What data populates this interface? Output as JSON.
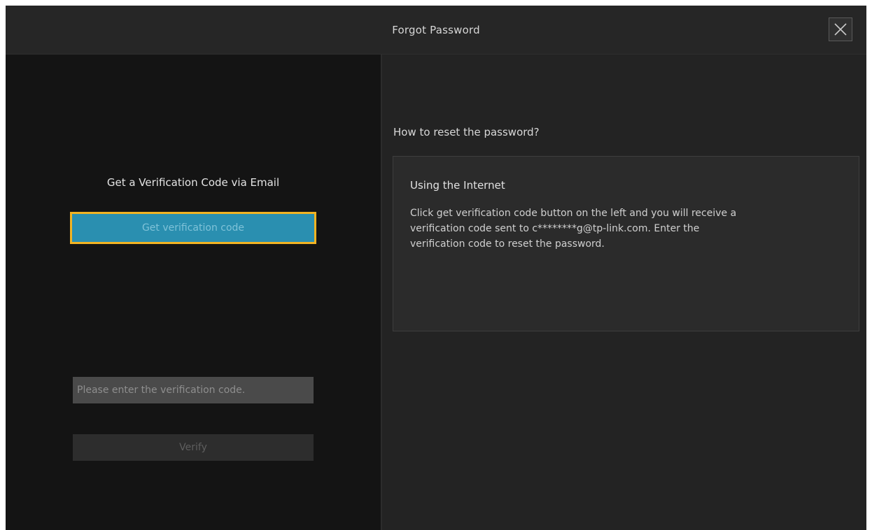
{
  "dialog": {
    "title": "Forgot Password",
    "close_icon": "close-icon"
  },
  "left": {
    "heading": "Get a Verification Code via Email",
    "get_code_label": "Get verification code",
    "code_input_placeholder": "Please enter the verification code.",
    "code_input_value": "",
    "verify_label": "Verify"
  },
  "right": {
    "heading": "How to reset the password?",
    "info_title": "Using the Internet",
    "info_body": "Click get verification code button on the left and you will receive a verification code sent to c********g@tp-link.com. Enter the verification code to reset the password."
  },
  "colors": {
    "accent_button": "#2a8fb0",
    "focus_border": "#f2b323",
    "dialog_bg": "#1f1f1f"
  }
}
